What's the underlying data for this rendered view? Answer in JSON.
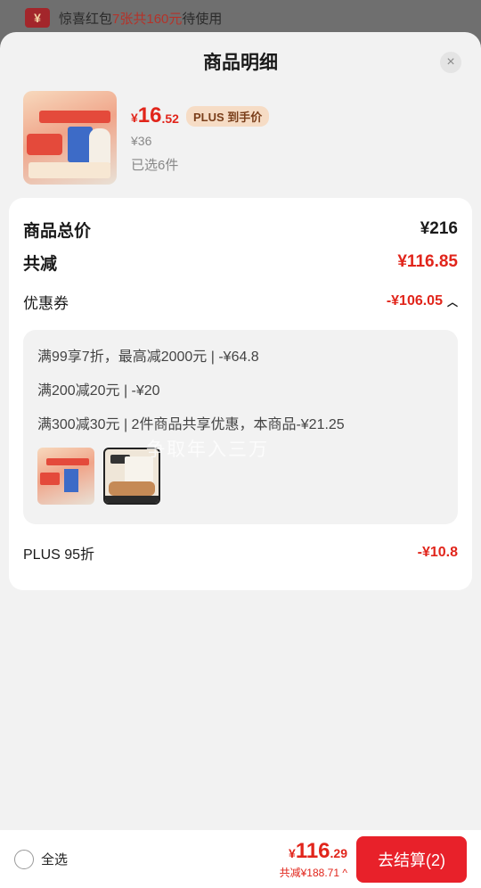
{
  "banner": {
    "text_prefix": "惊喜红包",
    "count": "7张共",
    "amount": "160元",
    "text_suffix": "待使用",
    "icon": "red-envelope-icon",
    "icon_glyph": "¥"
  },
  "sheet": {
    "title": "商品明细",
    "close_glyph": "×"
  },
  "product": {
    "price_symbol": "¥",
    "price_int": "16",
    "price_dec": ".52",
    "plus_tag": "PLUS 到手价",
    "original_price": "¥36",
    "selected": "已选6件"
  },
  "summary": {
    "total_label": "商品总价",
    "total_value": "¥216",
    "reduce_label": "共减",
    "reduce_value": "¥116.85",
    "coupon_label": "优惠券",
    "coupon_value": "-¥106.05",
    "coupon_lines": [
      "满99享7折，最高减2000元 | -¥64.8",
      "满200减20元 | -¥20",
      "满300减30元 | 2件商品共享优惠，本商品-¥21.25"
    ],
    "plus_label": "PLUS 95折",
    "plus_value": "-¥10.8"
  },
  "watermark": "争取年入三万",
  "bottom": {
    "select_all": "全选",
    "price_symbol": "¥",
    "price_int": "116",
    "price_dec": ".29",
    "reduce_text": "共减¥188.71",
    "chevron": "^",
    "checkout": "去结算(2)"
  },
  "colors": {
    "accent": "#e1251b",
    "button": "#e8212a",
    "plus_tag_bg": "#f6dcc5"
  }
}
